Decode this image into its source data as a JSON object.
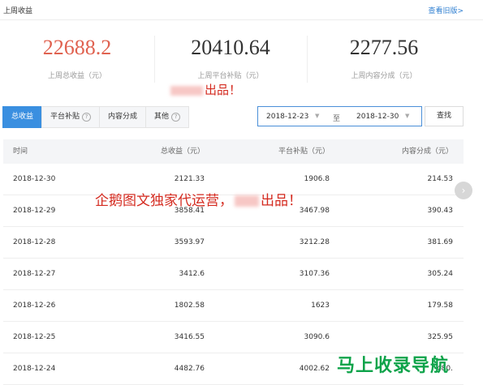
{
  "header": {
    "title": "上周收益",
    "history_link": "查看旧版>"
  },
  "stats": [
    {
      "value": "22688.2",
      "label": "上周总收益（元）"
    },
    {
      "value": "20410.64",
      "label": "上周平台补贴（元）"
    },
    {
      "value": "2277.56",
      "label": "上周内容分成（元）"
    }
  ],
  "watermark_top": "出品！",
  "tabs": [
    {
      "label": "总收益"
    },
    {
      "label": "平台补贴"
    },
    {
      "label": "内容分成"
    },
    {
      "label": "其他"
    }
  ],
  "date_range": {
    "start": "2018-12-23",
    "separator": "至",
    "end": "2018-12-30"
  },
  "search_button": "查找",
  "table": {
    "headers": [
      "时间",
      "总收益（元）",
      "平台补贴（元）",
      "内容分成（元）"
    ],
    "rows": [
      [
        "2018-12-30",
        "2121.33",
        "1906.8",
        "214.53"
      ],
      [
        "2018-12-29",
        "3858.41",
        "3467.98",
        "390.43"
      ],
      [
        "2018-12-28",
        "3593.97",
        "3212.28",
        "381.69"
      ],
      [
        "2018-12-27",
        "3412.6",
        "3107.36",
        "305.24"
      ],
      [
        "2018-12-26",
        "1802.58",
        "1623",
        "179.58"
      ],
      [
        "2018-12-25",
        "3416.55",
        "3090.6",
        "325.95"
      ],
      [
        "2018-12-24",
        "4482.76",
        "4002.62",
        "480."
      ]
    ]
  },
  "watermark_middle": {
    "part1": "企鹅图文独家代运营，",
    "part2": "出品！"
  },
  "logo": {
    "text": "马上收录导航"
  },
  "colors": {
    "accent_red": "#e06250",
    "tab_active": "#3a8fe0",
    "link": "#2f7fd1",
    "watermark": "#d42a1f",
    "logo_green": "#0ea34a"
  }
}
